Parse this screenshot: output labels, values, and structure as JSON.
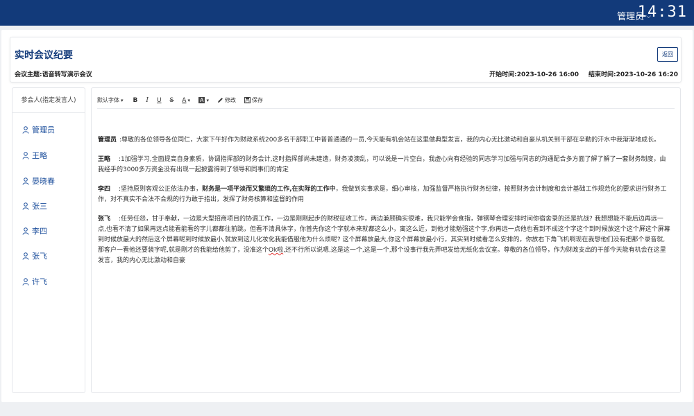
{
  "topbar": {
    "user_label": "管理员",
    "user_caret": "⌵",
    "clock": "14:31"
  },
  "header": {
    "title": "实时会议纪要",
    "back_label": "返回",
    "topic": "会议主题:语音转写演示会议",
    "start_time": "开始时间:2023-10-26 16:00",
    "end_time": "结束时间:2023-10-26 16:20"
  },
  "sidebar": {
    "title": "参会人(指定发言人)",
    "participants": [
      "管理员",
      "王略",
      "晏晓春",
      "张三",
      "李四",
      "张飞",
      "许飞"
    ]
  },
  "toolbar": {
    "font_label": "默认字体",
    "font_caret": "▾",
    "bold": "B",
    "italic": "I",
    "underline": "U",
    "strike": "S",
    "font_color": "A",
    "bg_color": "A",
    "edit_label": "修改",
    "save_label": "保存"
  },
  "transcript": [
    {
      "speaker": "管理员",
      "text": ":尊敬的各位领导各位同仁，大家下午好作为财政系统200多名干部职工中普普通通的一员,今天能有机会站在这里做典型发言，我的内心无比激动和自豪从机关到干部在辛勤的汗水中我渐渐地成长。"
    },
    {
      "speaker": "王略",
      "text": ":1加强学习,全面提高自身素质，协调指挥部的财务会计,这时指挥部尚未建造，财务凌澳乱，可以说是一片空白，我虚心向有经验的同志学习加强与同志的沟通配合多方面了解了解了一套财务制度，由我经手的3000多万资金没有出现一起披露得到了领导和同事们的肯定"
    },
    {
      "speaker": "李四",
      "text_before": ":坚持原则客观公正依法办事，",
      "text_bold": "财务是一项平淡而又繁琐的工作,在实际的工作中",
      "text_after": "，我做到实事求是，细心审核，加强监督严格执行财务纪律，按照财务会计制度和会计基础工作规范化的要求进行财务工作，对不真实不合法不合规的行为敢于指出，发挥了财务核算和监督的作用"
    },
    {
      "speaker": "张飞",
      "text_before": ":任劳任怨，甘于奉献，一边是大型招商项目的协调工作，一边是刚刚起步的财税征收工作，两边兼顾确实很难，我只能学会食指，弹钢琴合理安排时间你宿舍录的还是抗战? 我想想能不能后边再远一点,也看不清了如果再远点能看能看的字儿都都往前跳，但看不清具体字，你首先你这个字就本来就都这么小，离这么近，到他才能勉强这个字,你再远一点他也看到不成这个字这个到时候放这个这个屏这个屏幕到时候放最大的然后这个屏幕呢到时候放最小,就放到这儿化妆化我能借服他为什么烦呢? 这个屏幕放最大,你这个屏幕放最小行，其实到时候看怎么安排的，你放右下角飞机啊现在我想他们没有把那个录音就,那客户一看他还要装字呢,就是刚才的我能给他剪了，没准这个",
      "text_wavy": "Ok啦",
      "text_after": ",还不行所以说嗯,这是这一个,这是一个,那个设事行我先弄吧发给无纸化会议室。尊敬的各位领导，作为财政支出的干部今天能有机会在这里发言，我的内心无比激动和自豪"
    }
  ]
}
